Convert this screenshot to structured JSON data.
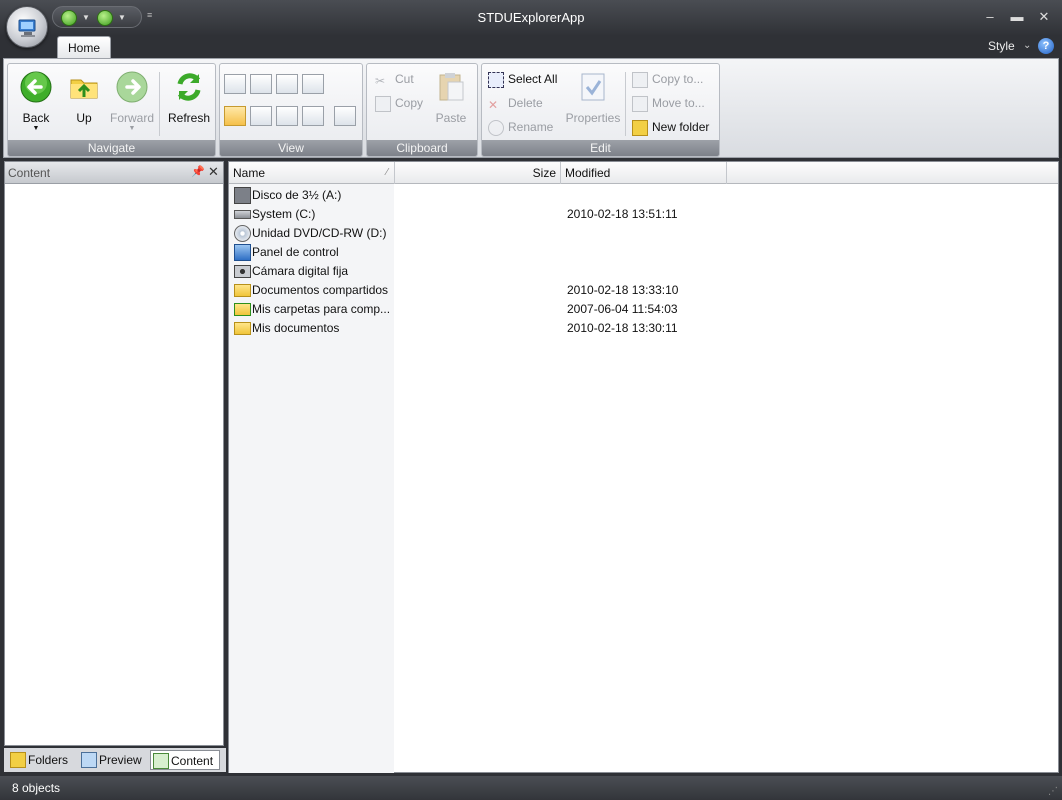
{
  "window": {
    "title": "STDUExplorerApp"
  },
  "ribbon": {
    "tabs": [
      {
        "label": "Home"
      }
    ],
    "style_label": "Style",
    "groups": {
      "navigate": {
        "label": "Navigate",
        "back": "Back",
        "up": "Up",
        "forward": "Forward",
        "refresh": "Refresh"
      },
      "view": {
        "label": "View"
      },
      "clipboard": {
        "label": "Clipboard",
        "cut": "Cut",
        "copy": "Copy",
        "paste": "Paste"
      },
      "edit": {
        "label": "Edit",
        "select_all": "Select All",
        "delete": "Delete",
        "rename": "Rename",
        "properties": "Properties",
        "copy_to": "Copy to...",
        "move_to": "Move to...",
        "new_folder": "New folder"
      }
    }
  },
  "left_panel": {
    "title": "Content",
    "tabs": [
      {
        "label": "Folders",
        "icon": "folders-icon"
      },
      {
        "label": "Preview",
        "icon": "preview-icon"
      },
      {
        "label": "Content",
        "icon": "content-icon"
      }
    ]
  },
  "file_list": {
    "columns": {
      "name": "Name",
      "size": "Size",
      "modified": "Modified"
    },
    "items": [
      {
        "name": "Disco de 3½ (A:)",
        "modified": "",
        "icon": "floppy-drive-icon"
      },
      {
        "name": "System (C:)",
        "modified": "2010-02-18 13:51:11",
        "icon": "hard-drive-icon"
      },
      {
        "name": "Unidad DVD/CD-RW (D:)",
        "modified": "",
        "icon": "dvd-drive-icon"
      },
      {
        "name": "Panel de control",
        "modified": "",
        "icon": "control-panel-icon"
      },
      {
        "name": "Cámara digital fija",
        "modified": "",
        "icon": "camera-icon"
      },
      {
        "name": "Documentos compartidos",
        "modified": "2010-02-18 13:33:10",
        "icon": "folder-icon"
      },
      {
        "name": "Mis carpetas para comp...",
        "modified": "2007-06-04 11:54:03",
        "icon": "shared-folder-icon"
      },
      {
        "name": "Mis documentos",
        "modified": "2010-02-18 13:30:11",
        "icon": "folder-icon"
      }
    ]
  },
  "status": {
    "text": "8 objects"
  }
}
